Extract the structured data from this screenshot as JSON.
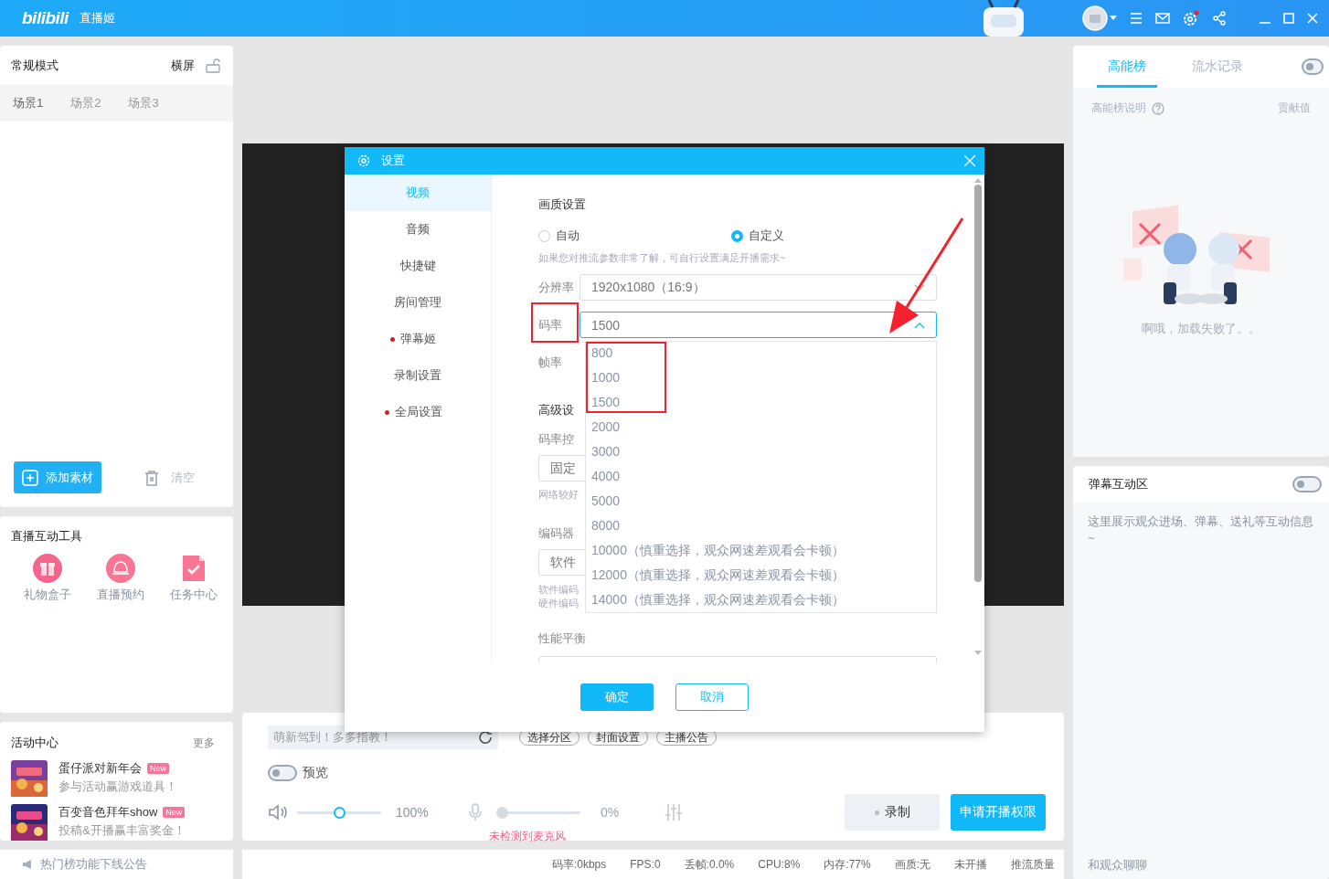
{
  "app": {
    "logo": "bilibili",
    "title": "直播姬"
  },
  "left_panel": {
    "mode": "常规模式",
    "orientation": "横屏",
    "scenes": [
      {
        "label": "场景1",
        "selected": true
      },
      {
        "label": "场景2",
        "selected": false
      },
      {
        "label": "场景3",
        "selected": false
      }
    ],
    "add_button": "添加素材",
    "clear_button": "清空"
  },
  "tools": {
    "title": "直播互动工具",
    "items": [
      {
        "kind": "gift",
        "label": "礼物盒子"
      },
      {
        "kind": "bell",
        "label": "直播预约"
      },
      {
        "kind": "task",
        "label": "任务中心"
      }
    ]
  },
  "activities": {
    "title": "活动中心",
    "more": "更多",
    "items": [
      {
        "title": "蛋仔派对新年会",
        "badge": "New",
        "subtitle": "参与活动赢游戏道具！"
      },
      {
        "title": "百变音色拜年show",
        "badge": "New",
        "subtitle": "投稿&开播赢丰富奖金！"
      }
    ]
  },
  "stream": {
    "title_value": "萌新驾到！多多指教！",
    "chips": [
      "选择分区",
      "封面设置",
      "主播公告"
    ],
    "preview": {
      "label": "预览",
      "on": false
    },
    "volume": {
      "level": 0.5,
      "reading": "100%"
    },
    "mic": {
      "level": 0,
      "reading": "0%",
      "warning": "未检测到麦克风"
    },
    "record": "录制",
    "apply": "申请开播权限"
  },
  "status_bar": {
    "notice": "热门榜功能下线公告",
    "stats": [
      "码率:0kbps",
      "FPS:0",
      "丢帧:0.0%",
      "CPU:8%",
      "内存:77%",
      "画质:无",
      "未开播",
      "推流质量"
    ]
  },
  "ranking": {
    "tabs": [
      {
        "label": "高能榜",
        "selected": true
      },
      {
        "label": "流水记录",
        "selected": false
      }
    ],
    "on": false,
    "help": "高能榜说明",
    "column": "贡献值",
    "error": "啊哦，加载失败了。。"
  },
  "danmaku": {
    "title": "弹幕互动区",
    "on": false,
    "hint": "这里展示观众进场、弹幕、送礼等互动信息~",
    "placeholder": "和观众聊聊"
  },
  "dialog": {
    "title": "设置",
    "nav": [
      {
        "label": "视频",
        "selected": true,
        "dot": false
      },
      {
        "label": "音频",
        "selected": false,
        "dot": false
      },
      {
        "label": "快捷键",
        "selected": false,
        "dot": false
      },
      {
        "label": "房间管理",
        "selected": false,
        "dot": false
      },
      {
        "label": "弹幕姬",
        "selected": false,
        "dot": true
      },
      {
        "label": "录制设置",
        "selected": false,
        "dot": false
      },
      {
        "label": "全局设置",
        "selected": false,
        "dot": true
      }
    ],
    "section": "画质设置",
    "radios": [
      {
        "label": "自动",
        "selected": false
      },
      {
        "label": "自定义",
        "selected": true
      }
    ],
    "hint": "如果您对推流参数非常了解，可自行设置满足开播需求~",
    "resolution": {
      "label": "分辨率",
      "value": "1920x1080（16:9）"
    },
    "bitrate": {
      "label": "码率",
      "value": "1500",
      "expanded": true,
      "options": [
        "800",
        "1000",
        "1500",
        "2000",
        "3000",
        "4000",
        "5000",
        "8000",
        "10000（慎重选择，观众网速差观看会卡顿）",
        "12000（慎重选择，观众网速差观看会卡顿）",
        "14000（慎重选择，观众网速差观看会卡顿）"
      ]
    },
    "framerate_label": "帧率",
    "advanced": "高级设",
    "rate_control": {
      "label": "码率控",
      "value": "固定",
      "hint": "网络较好"
    },
    "encoder": {
      "label": "编码器",
      "value": "软件",
      "notes": [
        "软件编码",
        "硬件编码"
      ]
    },
    "performance": "性能平衡",
    "ok": "确定",
    "cancel": "取消"
  }
}
